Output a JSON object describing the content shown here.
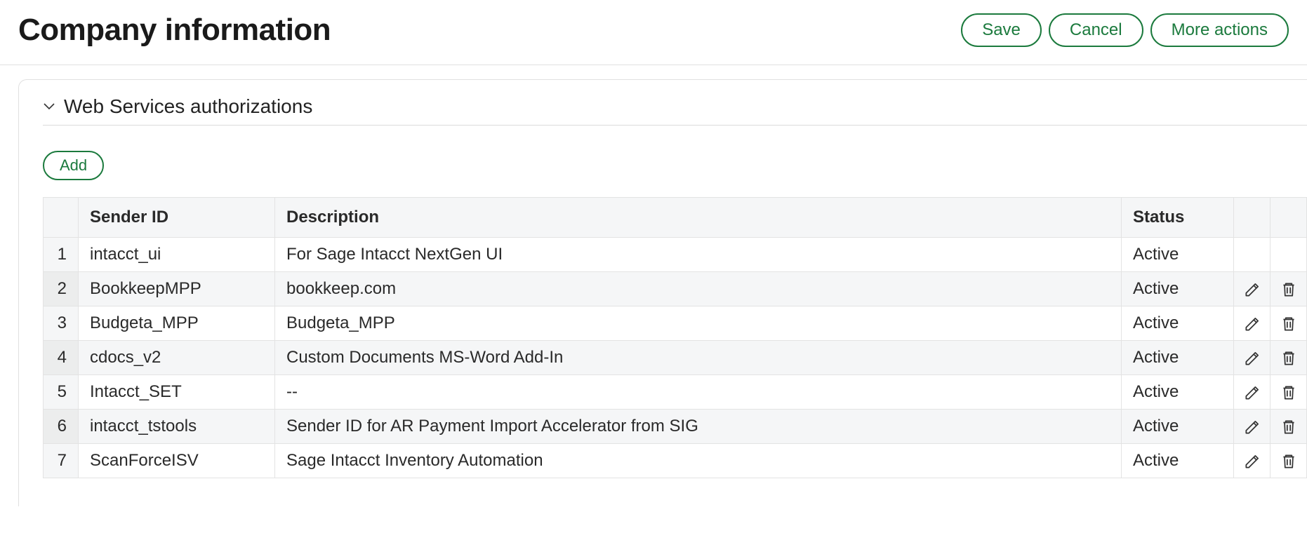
{
  "header": {
    "title": "Company information",
    "save_label": "Save",
    "cancel_label": "Cancel",
    "more_actions_label": "More actions"
  },
  "section": {
    "title": "Web Services authorizations",
    "add_label": "Add"
  },
  "table": {
    "columns": {
      "sender_id": "Sender ID",
      "description": "Description",
      "status": "Status"
    },
    "rows": [
      {
        "n": "1",
        "sender_id": "intacct_ui",
        "description": "For Sage Intacct NextGen UI",
        "status": "Active",
        "has_actions": false
      },
      {
        "n": "2",
        "sender_id": "BookkeepMPP",
        "description": "bookkeep.com",
        "status": "Active",
        "has_actions": true
      },
      {
        "n": "3",
        "sender_id": "Budgeta_MPP",
        "description": "Budgeta_MPP",
        "status": "Active",
        "has_actions": true
      },
      {
        "n": "4",
        "sender_id": "cdocs_v2",
        "description": "Custom Documents MS-Word Add-In",
        "status": "Active",
        "has_actions": true
      },
      {
        "n": "5",
        "sender_id": "Intacct_SET",
        "description": "--",
        "status": "Active",
        "has_actions": true
      },
      {
        "n": "6",
        "sender_id": "intacct_tstools",
        "description": "Sender ID for AR Payment Import Accelerator from SIG",
        "status": "Active",
        "has_actions": true
      },
      {
        "n": "7",
        "sender_id": "ScanForceISV",
        "description": "Sage Intacct Inventory Automation",
        "status": "Active",
        "has_actions": true
      }
    ]
  }
}
